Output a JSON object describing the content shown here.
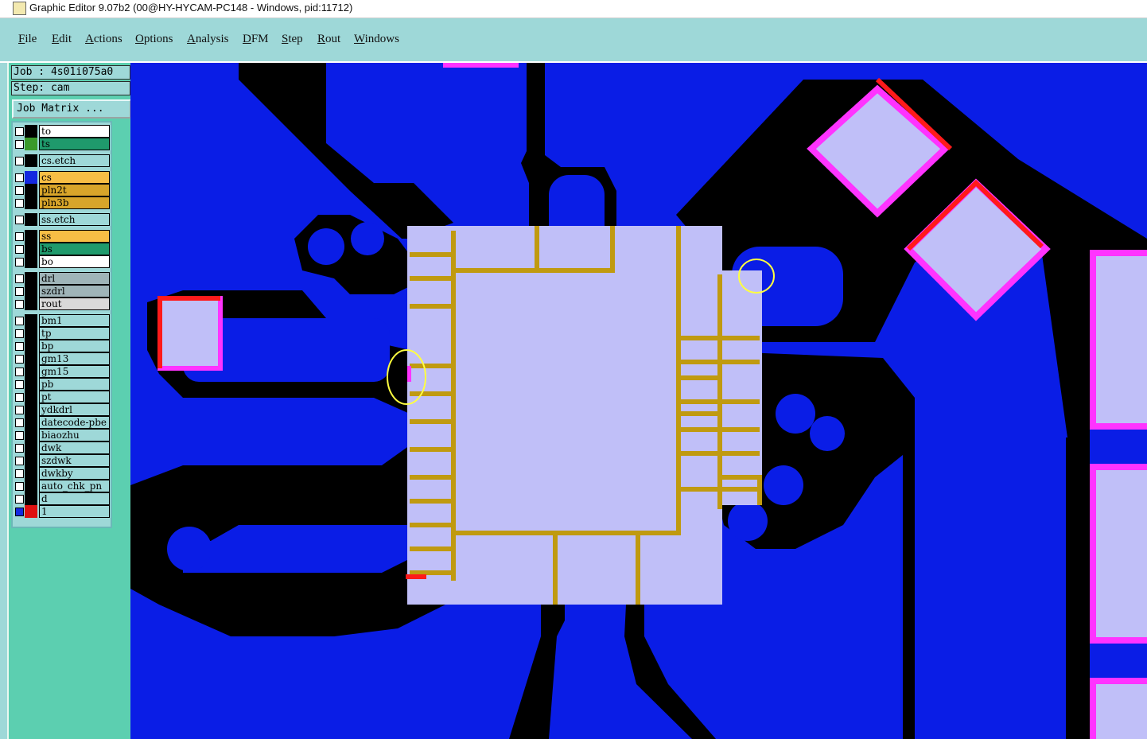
{
  "window": {
    "title": "Graphic Editor 9.07b2 (00@HY-HYCAM-PC148 - Windows, pid:11712)"
  },
  "menu": {
    "items": [
      "File",
      "Edit",
      "Actions",
      "Options",
      "Analysis",
      "DFM",
      "Step",
      "Rout",
      "Windows"
    ]
  },
  "panel": {
    "job_label": "Job : 4s01i075a0",
    "step_label": "Step: cam",
    "job_matrix_button": "Job Matrix ..."
  },
  "layers": [
    {
      "name": "to",
      "bg": "#ffffff",
      "swatch": "#000000"
    },
    {
      "name": "ts",
      "bg": "#1f9a6c",
      "swatch": "#3a9a2a"
    },
    {
      "name": "cs.etch",
      "bg": "#9ed8d8",
      "swatch": "#000000"
    },
    {
      "name": "cs",
      "bg": "#f7be45",
      "swatch": "#1428e0"
    },
    {
      "name": "pln2t",
      "bg": "#d8a52a",
      "swatch": "#000000"
    },
    {
      "name": "pln3b",
      "bg": "#d8a52a",
      "swatch": "#000000"
    },
    {
      "name": "ss.etch",
      "bg": "#9ed8d8",
      "swatch": "#000000"
    },
    {
      "name": "ss",
      "bg": "#f7be45",
      "swatch": "#000000"
    },
    {
      "name": "bs",
      "bg": "#1f9a6c",
      "swatch": "#000000"
    },
    {
      "name": "bo",
      "bg": "#ffffff",
      "swatch": "#000000"
    },
    {
      "name": "drl",
      "bg": "#9fb4b8",
      "swatch": "#000000"
    },
    {
      "name": "szdrl",
      "bg": "#9fb4b8",
      "swatch": "#000000"
    },
    {
      "name": "rout",
      "bg": "#d9d9d9",
      "swatch": "#000000"
    },
    {
      "name": "bm1",
      "bg": "#9ed8d8",
      "swatch": "#000000"
    },
    {
      "name": "tp",
      "bg": "#9ed8d8",
      "swatch": "#000000"
    },
    {
      "name": "bp",
      "bg": "#9ed8d8",
      "swatch": "#000000"
    },
    {
      "name": "gm13",
      "bg": "#9ed8d8",
      "swatch": "#000000"
    },
    {
      "name": "gm15",
      "bg": "#9ed8d8",
      "swatch": "#000000"
    },
    {
      "name": "pb",
      "bg": "#9ed8d8",
      "swatch": "#000000"
    },
    {
      "name": "pt",
      "bg": "#9ed8d8",
      "swatch": "#000000"
    },
    {
      "name": "ydkdrl",
      "bg": "#9ed8d8",
      "swatch": "#000000"
    },
    {
      "name": "datecode-pbe",
      "bg": "#9ed8d8",
      "swatch": "#000000"
    },
    {
      "name": "biaozhu",
      "bg": "#9ed8d8",
      "swatch": "#000000"
    },
    {
      "name": "dwk",
      "bg": "#9ed8d8",
      "swatch": "#000000"
    },
    {
      "name": "szdwk",
      "bg": "#9ed8d8",
      "swatch": "#000000"
    },
    {
      "name": "dwkby",
      "bg": "#9ed8d8",
      "swatch": "#000000"
    },
    {
      "name": "auto_chk_pn",
      "bg": "#9ed8d8",
      "swatch": "#000000"
    },
    {
      "name": "d",
      "bg": "#9ed8d8",
      "swatch": "#000000"
    },
    {
      "name": "1",
      "bg": "#9ed8d8",
      "swatch": "#e01010"
    }
  ],
  "colors": {
    "copper": "#0a1de6",
    "clearance": "#000000",
    "pad_fill": "#c0bff8",
    "pad_outline_magenta": "#ff33ff",
    "pad_outline_red": "#ff1a1a",
    "trace_gold": "#c09a10",
    "marker_yellow": "#ffff40"
  }
}
